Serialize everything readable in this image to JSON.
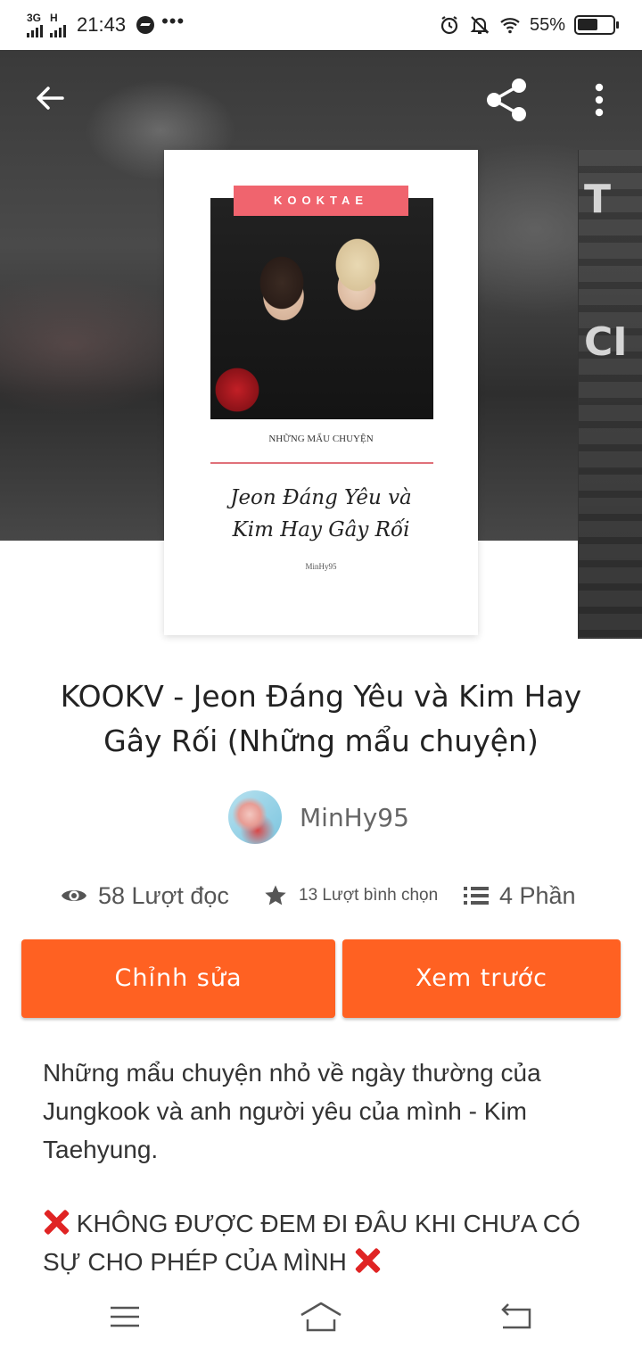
{
  "status_bar": {
    "network_top": "3G",
    "network_second": "H",
    "time": "21:43",
    "overflow": "•••",
    "battery_percent": "55%",
    "icons": [
      "signal-icon",
      "messenger-icon",
      "alarm-icon",
      "mute-icon",
      "wifi-icon",
      "battery-icon"
    ]
  },
  "header": {
    "icons": [
      "back-arrow-icon",
      "share-icon",
      "more-vertical-icon"
    ]
  },
  "cover": {
    "tag": "KOOKTAE",
    "subtitle": "NHỮNG MẨU CHUYỆN",
    "title_line1": "Jeon Đáng Yêu và",
    "title_line2": "Kim Hay Gây Rối",
    "author": "MinHy95"
  },
  "next_cover": {
    "text_top": "T",
    "text_mid": "CI"
  },
  "story": {
    "title": "KOOKV - Jeon Đáng Yêu và Kim Hay Gây Rối (Những mẩu chuyện)",
    "author_name": "MinHy95"
  },
  "stats": {
    "reads": "58 Lượt đọc",
    "votes": "13 Lượt bình chọn",
    "parts": "4 Phần"
  },
  "buttons": {
    "edit": "Chỉnh sửa",
    "preview": "Xem trước"
  },
  "description": {
    "paragraph": "Những mẩu chuyện nhỏ về ngày thường của Jungkook và anh người yêu của mình - Kim Taehyung.",
    "warning": "KHÔNG ĐƯỢC ĐEM ĐI ĐÂU KHI CHƯA CÓ SỰ CHO PHÉP CỦA MÌNH"
  },
  "nav_bar": {
    "icons": [
      "menu-icon",
      "home-icon",
      "back-icon"
    ]
  },
  "colors": {
    "accent": "#ff6122",
    "cover_tag": "#f0646e",
    "warning_x": "#e02424"
  }
}
